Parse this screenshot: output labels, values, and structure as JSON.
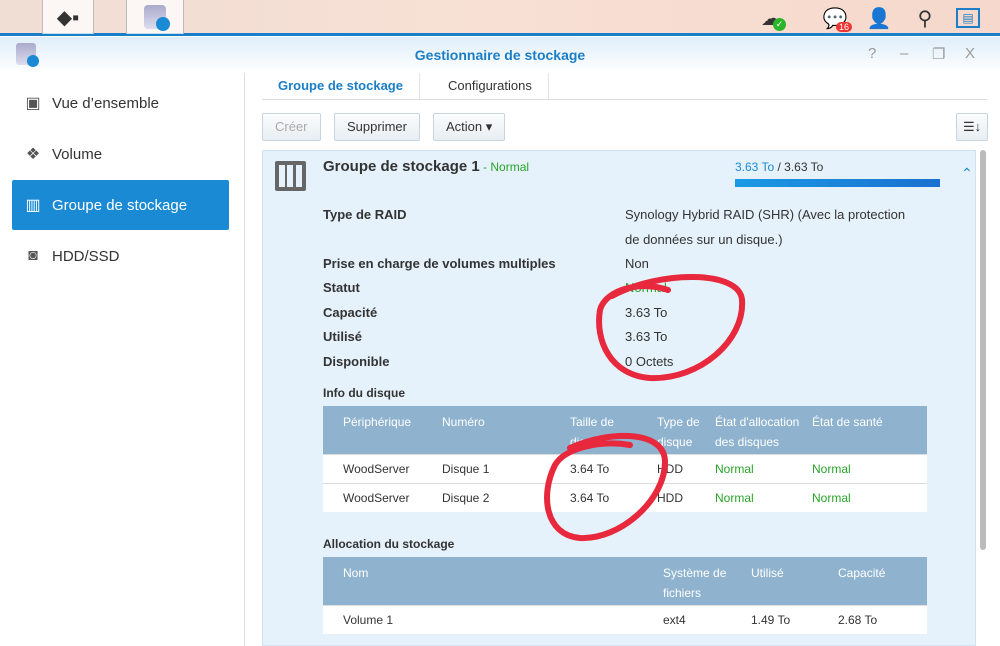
{
  "taskbar": {
    "notification_count": "16"
  },
  "window": {
    "title": "Gestionnaire de stockage",
    "help": "?",
    "minimize": "–",
    "restore": "❐",
    "close": "X"
  },
  "sidebar": {
    "items": [
      {
        "label": "Vue d’ensemble",
        "icon": "overview-icon"
      },
      {
        "label": "Volume",
        "icon": "cubes-icon"
      },
      {
        "label": "Groupe de stockage",
        "icon": "storage-pool-icon",
        "active": true
      },
      {
        "label": "HDD/SSD",
        "icon": "disk-icon"
      }
    ]
  },
  "tabs": [
    {
      "label": "Groupe de stockage",
      "active": true
    },
    {
      "label": "Configurations"
    }
  ],
  "toolbar": {
    "create": "Créer",
    "delete": "Supprimer",
    "action": "Action ▾"
  },
  "pool": {
    "name": "Groupe de stockage 1",
    "sep": " - ",
    "status": "Normal",
    "used": "3.63 To",
    "total": " / 3.63 To",
    "usage_percent": 100,
    "details": [
      {
        "label": "Type de RAID",
        "value": "Synology Hybrid RAID (SHR) (Avec la protection",
        "value2": "de données sur un disque.)"
      },
      {
        "label": "Prise en charge de volumes multiples",
        "value": "Non"
      },
      {
        "label": "Statut",
        "value": "Normal"
      },
      {
        "label": "Capacité",
        "value": "3.63 To"
      },
      {
        "label": "Utilisé",
        "value": "3.63 To"
      },
      {
        "label": "Disponible",
        "value": "0 Octets"
      }
    ],
    "disk_info_title": "Info du disque",
    "disk_headers": [
      "Périphérique",
      "Numéro",
      "Taille de disque",
      "Type de disque",
      "État d'allocation des disques",
      "État de santé"
    ],
    "disks": [
      [
        "WoodServer",
        "Disque 1",
        "3.64 To",
        "HDD",
        "Normal",
        "Normal"
      ],
      [
        "WoodServer",
        "Disque 2",
        "3.64 To",
        "HDD",
        "Normal",
        "Normal"
      ]
    ],
    "alloc_title": "Allocation du stockage",
    "alloc_headers": [
      "Nom",
      "Système de fichiers",
      "Utilisé",
      "Capacité"
    ],
    "alloc_rows": [
      [
        "Volume 1",
        "ext4",
        "1.49 To",
        "2.68 To"
      ]
    ]
  },
  "colors": {
    "accent": "#1a8ad4",
    "status_green": "#28a428",
    "annotation": "#e8283c"
  }
}
